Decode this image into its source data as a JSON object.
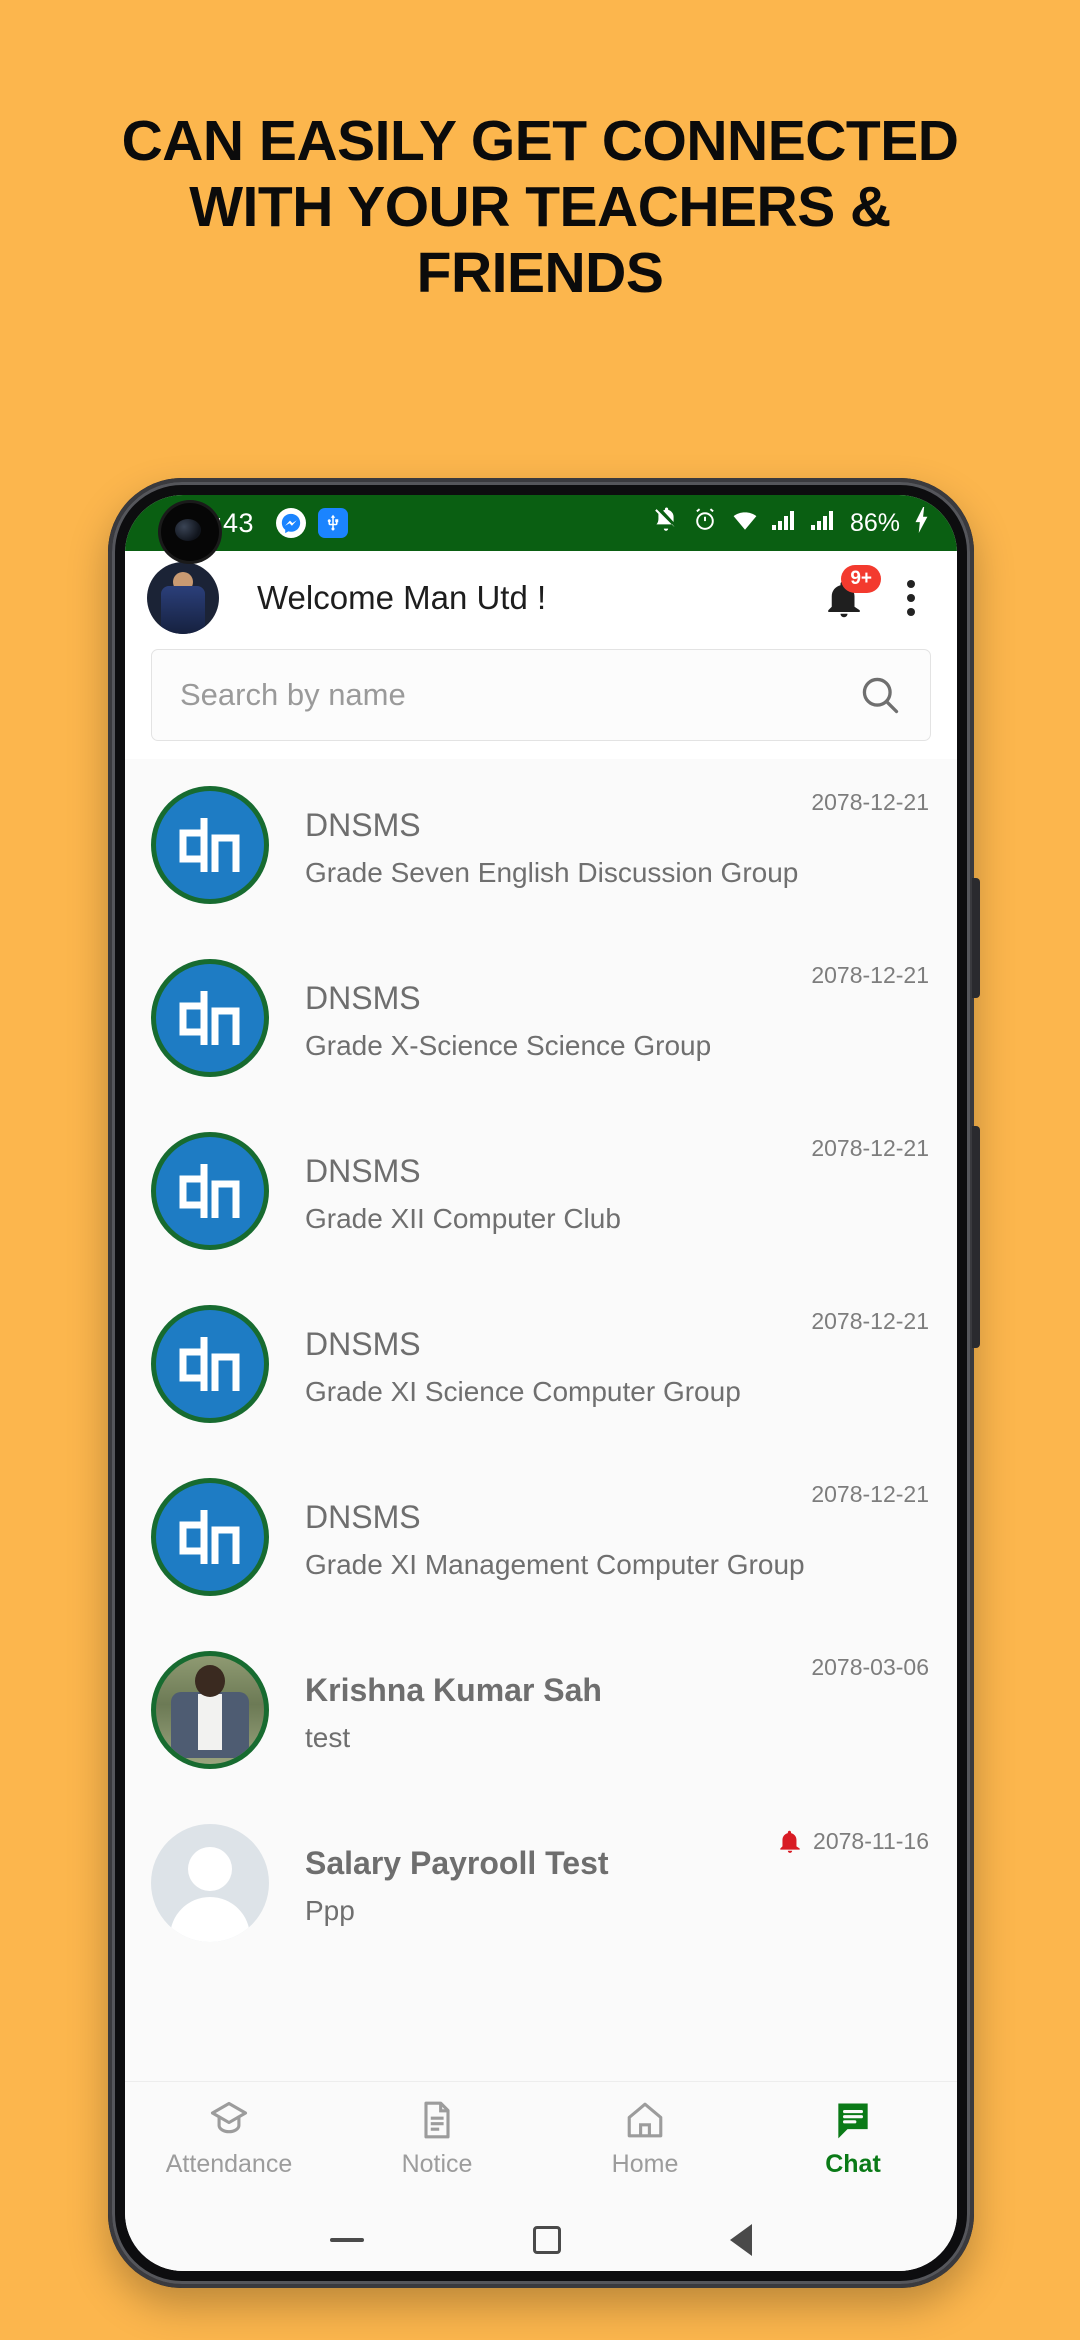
{
  "promo": {
    "headline": "CAN EASILY GET CONNECTED WITH YOUR TEACHERS & FRIENDS",
    "background_color": "#FCB64D"
  },
  "statusbar": {
    "time": ":43",
    "battery_percent": "86%",
    "icons": [
      "messenger-icon",
      "usb-icon",
      "bell-muted-icon",
      "alarm-icon",
      "wifi-icon",
      "signal-icon-1",
      "signal-icon-2",
      "charging-bolt-icon"
    ],
    "background_color": "#0A5F12"
  },
  "appbar": {
    "title": "Welcome Man Utd !",
    "avatar_name": "user-avatar",
    "notification_badge": "9+",
    "badge_color": "#F33A2E",
    "bell_icon": "bell-icon",
    "menu_icon": "overflow-menu-icon"
  },
  "search": {
    "placeholder": "Search by name",
    "value": "",
    "icon": "search-icon"
  },
  "chats": [
    {
      "name": "DNSMS",
      "message": "Grade Seven English Discussion Group",
      "date": "2078-12-21",
      "avatar": "dnsms-logo",
      "bold": false,
      "muted": false
    },
    {
      "name": "DNSMS",
      "message": "Grade X-Science Science Group",
      "date": "2078-12-21",
      "avatar": "dnsms-logo",
      "bold": false,
      "muted": false
    },
    {
      "name": "DNSMS",
      "message": "Grade XII Computer Club",
      "date": "2078-12-21",
      "avatar": "dnsms-logo",
      "bold": false,
      "muted": false
    },
    {
      "name": "DNSMS",
      "message": "Grade XI Science Computer Group",
      "date": "2078-12-21",
      "avatar": "dnsms-logo",
      "bold": false,
      "muted": false
    },
    {
      "name": "DNSMS",
      "message": "Grade XI Management Computer Group",
      "date": "2078-12-21",
      "avatar": "dnsms-logo",
      "bold": false,
      "muted": false
    },
    {
      "name": "Krishna Kumar Sah",
      "message": "test",
      "date": "2078-03-06",
      "avatar": "person-photo",
      "bold": true,
      "muted": false
    },
    {
      "name": "Salary Payrooll Test",
      "message": "Ppp",
      "date": "2078-11-16",
      "avatar": "placeholder-person",
      "bold": true,
      "muted": true
    }
  ],
  "bottomnav": {
    "active_color": "#0A7A17",
    "inactive_color": "#9C9C9C",
    "items": [
      {
        "label": "Attendance",
        "icon": "graduation-cap-icon",
        "active": false
      },
      {
        "label": "Notice",
        "icon": "document-icon",
        "active": false
      },
      {
        "label": "Home",
        "icon": "home-icon",
        "active": false
      },
      {
        "label": "Chat",
        "icon": "chat-bubble-icon",
        "active": true
      }
    ]
  }
}
